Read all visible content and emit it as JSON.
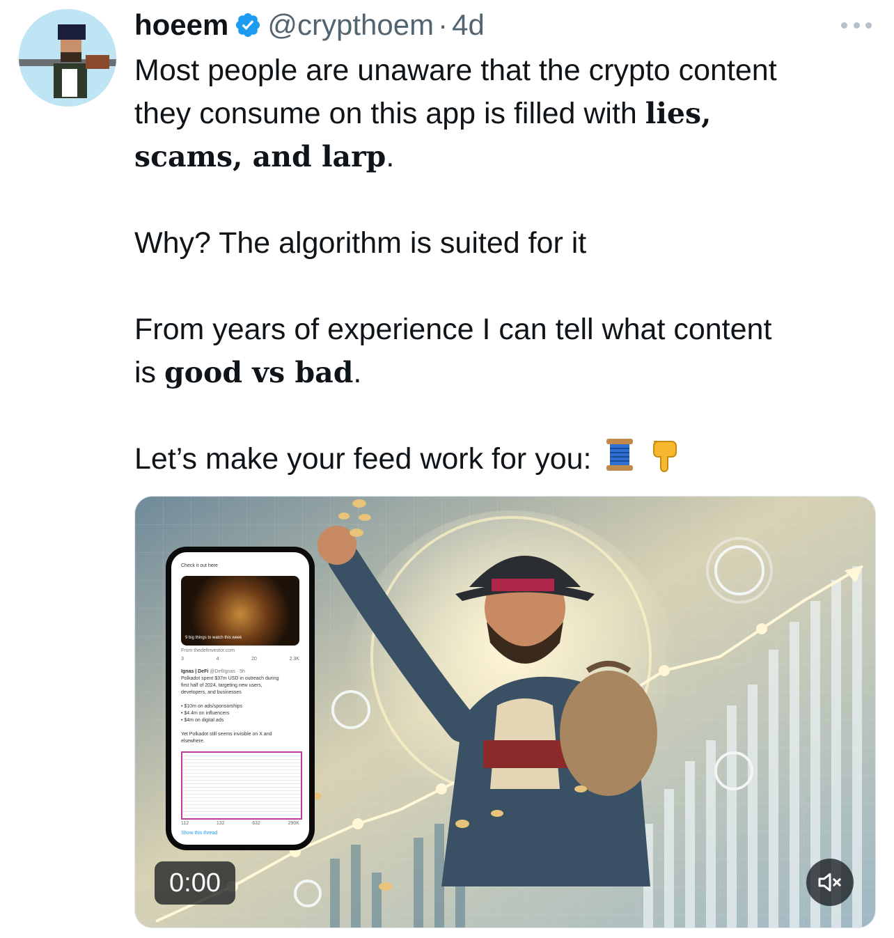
{
  "tweet": {
    "author_name": "hoeem",
    "handle": "@crypthoem",
    "separator": "·",
    "time": "4d",
    "line1_a": "Most people are unaware that the crypto content",
    "line2_a": "they consume on this app is filled with ",
    "line2_bold": "lies,",
    "line3_bold": "scams, and larp",
    "line3_end": ".",
    "line4": "Why? The algorithm is suited for it",
    "line5": "From years of experience I can tell what content",
    "line6_a": "is ",
    "line6_bold": "good vs bad",
    "line6_end": ".",
    "line7": "Let’s make your feed work for you:",
    "emoji_icons": [
      "thread-spool-icon",
      "pointing-down-icon"
    ]
  },
  "media": {
    "type": "video",
    "timer": "0:00",
    "mute_icon": "speaker-muted-icon",
    "phone_screen": {
      "top": "Check it out here",
      "caption": "9 big things to watch this week",
      "source": "From thedefinvestor.com",
      "stats1": [
        "3",
        "4",
        "20",
        "2.3K"
      ],
      "author": "Ignas | DeFi",
      "author_handle": "@DefiIgnas · 5h",
      "body1": "Polkadot spent $37m USD in outreach during",
      "body2": "first half of 2024, targeting new users,",
      "body3": "developers, and businesses",
      "b1": "• $10m on ads/sponsorships",
      "b2": "• $4.4m on influencers",
      "b3": "• $4m on digital ads",
      "body4": "Yet Polkadot still seems invisible on X and",
      "body5": "elsewhere.",
      "stats2": [
        "112",
        "132",
        "632",
        "290K"
      ],
      "show_thread": "Show this thread"
    }
  },
  "colors": {
    "verified": "#1d9bf0",
    "muted_text": "#536471"
  }
}
